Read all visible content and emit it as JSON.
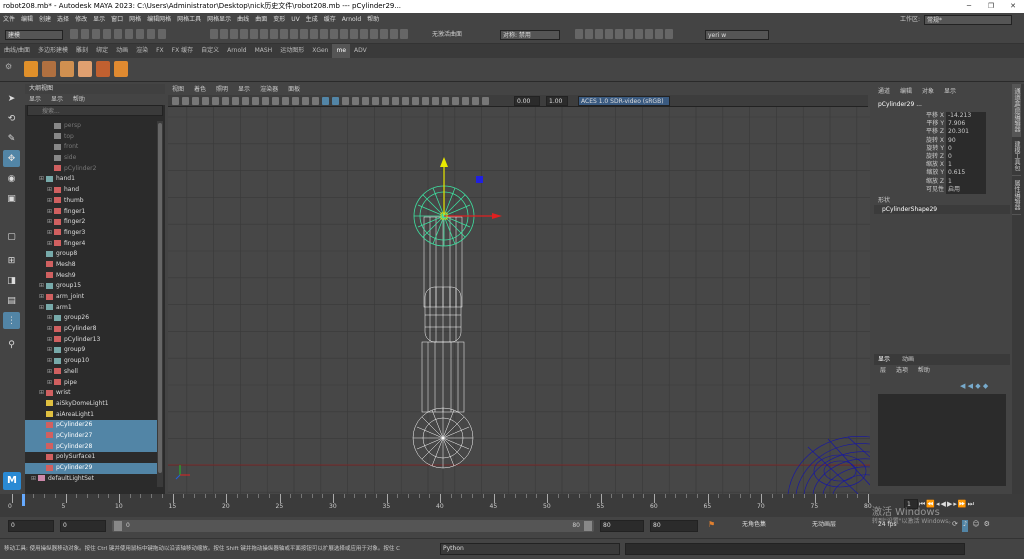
{
  "title": "robot208.mb* - Autodesk MAYA 2023: C:\\Users\\Administrator\\Desktop\\nick历史文件\\robot208.mb --- pCylinder29...",
  "menus": [
    "文件",
    "编辑",
    "创建",
    "选择",
    "修改",
    "显示",
    "窗口",
    "网格",
    "编辑网格",
    "网格工具",
    "网格显示",
    "曲线",
    "曲面",
    "变形",
    "UV",
    "生成",
    "缓存",
    "Arnold",
    "帮助"
  ],
  "workspace_label": "工作区:",
  "workspace_value": "常规*",
  "mode_value": "建模",
  "no_live_surface": "无激活曲面",
  "symmetry": "对称: 禁用",
  "user": "yeri w",
  "shelf_tabs": [
    "曲线/曲面",
    "多边形建模",
    "雕刻",
    "绑定",
    "动画",
    "渲染",
    "FX",
    "FX 缓存",
    "自定义",
    "Arnold",
    "MASH",
    "运动图形",
    "XGen",
    "me",
    "ADV"
  ],
  "shelf_active": 13,
  "outliner": {
    "header": "大纲视图",
    "menu": [
      "显示",
      "显示",
      "帮助"
    ],
    "search_placeholder": "搜索...",
    "items": [
      {
        "label": "persp",
        "indent": 2,
        "dim": true,
        "sel": false,
        "exp": false,
        "icon": "camera"
      },
      {
        "label": "top",
        "indent": 2,
        "dim": true,
        "sel": false,
        "exp": false,
        "icon": "camera"
      },
      {
        "label": "front",
        "indent": 2,
        "dim": true,
        "sel": false,
        "exp": false,
        "icon": "camera"
      },
      {
        "label": "side",
        "indent": 2,
        "dim": true,
        "sel": false,
        "exp": false,
        "icon": "camera"
      },
      {
        "label": "pCylinder2",
        "indent": 2,
        "dim": true,
        "sel": false,
        "exp": false,
        "icon": "mesh"
      },
      {
        "label": "hand1",
        "indent": 1,
        "dim": false,
        "sel": false,
        "exp": true,
        "icon": "group"
      },
      {
        "label": "hand",
        "indent": 2,
        "dim": false,
        "sel": false,
        "exp": true,
        "icon": "mesh"
      },
      {
        "label": "thumb",
        "indent": 2,
        "dim": false,
        "sel": false,
        "exp": true,
        "icon": "mesh"
      },
      {
        "label": "finger1",
        "indent": 2,
        "dim": false,
        "sel": false,
        "exp": true,
        "icon": "mesh"
      },
      {
        "label": "finger2",
        "indent": 2,
        "dim": false,
        "sel": false,
        "exp": true,
        "icon": "mesh"
      },
      {
        "label": "finger3",
        "indent": 2,
        "dim": false,
        "sel": false,
        "exp": true,
        "icon": "mesh"
      },
      {
        "label": "finger4",
        "indent": 2,
        "dim": false,
        "sel": false,
        "exp": true,
        "icon": "mesh"
      },
      {
        "label": "group8",
        "indent": 1,
        "dim": false,
        "sel": false,
        "exp": false,
        "icon": "group"
      },
      {
        "label": "Mesh8",
        "indent": 1,
        "dim": false,
        "sel": false,
        "exp": false,
        "icon": "mesh"
      },
      {
        "label": "Mesh9",
        "indent": 1,
        "dim": false,
        "sel": false,
        "exp": false,
        "icon": "mesh"
      },
      {
        "label": "group15",
        "indent": 1,
        "dim": false,
        "sel": false,
        "exp": true,
        "icon": "group"
      },
      {
        "label": "arm_joint",
        "indent": 1,
        "dim": false,
        "sel": false,
        "exp": true,
        "icon": "mesh"
      },
      {
        "label": "arm1",
        "indent": 1,
        "dim": false,
        "sel": false,
        "exp": true,
        "icon": "group"
      },
      {
        "label": "group26",
        "indent": 2,
        "dim": false,
        "sel": false,
        "exp": true,
        "icon": "group"
      },
      {
        "label": "pCylinder8",
        "indent": 2,
        "dim": false,
        "sel": false,
        "exp": true,
        "icon": "mesh"
      },
      {
        "label": "pCylinder13",
        "indent": 2,
        "dim": false,
        "sel": false,
        "exp": true,
        "icon": "mesh"
      },
      {
        "label": "group9",
        "indent": 2,
        "dim": false,
        "sel": false,
        "exp": true,
        "icon": "group"
      },
      {
        "label": "group10",
        "indent": 2,
        "dim": false,
        "sel": false,
        "exp": true,
        "icon": "group"
      },
      {
        "label": "shell",
        "indent": 2,
        "dim": false,
        "sel": false,
        "exp": true,
        "icon": "mesh"
      },
      {
        "label": "pipe",
        "indent": 2,
        "dim": false,
        "sel": false,
        "exp": true,
        "icon": "mesh"
      },
      {
        "label": "wrist",
        "indent": 1,
        "dim": false,
        "sel": false,
        "exp": true,
        "icon": "mesh"
      },
      {
        "label": "aiSkyDomeLight1",
        "indent": 1,
        "dim": false,
        "sel": false,
        "exp": false,
        "icon": "light"
      },
      {
        "label": "aiAreaLight1",
        "indent": 1,
        "dim": false,
        "sel": false,
        "exp": false,
        "icon": "light"
      },
      {
        "label": "pCylinder26",
        "indent": 1,
        "dim": false,
        "sel": true,
        "exp": false,
        "icon": "mesh"
      },
      {
        "label": "pCylinder27",
        "indent": 1,
        "dim": false,
        "sel": true,
        "exp": false,
        "icon": "mesh"
      },
      {
        "label": "pCylinder28",
        "indent": 1,
        "dim": false,
        "sel": true,
        "exp": false,
        "icon": "mesh"
      },
      {
        "label": "polySurface1",
        "indent": 1,
        "dim": false,
        "sel": false,
        "exp": false,
        "icon": "mesh"
      },
      {
        "label": "pCylinder29",
        "indent": 1,
        "dim": false,
        "sel": true,
        "exp": false,
        "icon": "mesh"
      },
      {
        "label": "defaultLightSet",
        "indent": 0,
        "dim": false,
        "sel": false,
        "exp": true,
        "icon": "set"
      }
    ]
  },
  "viewport_menu": [
    "视图",
    "着色",
    "照明",
    "显示",
    "渲染器",
    "面板"
  ],
  "viewport_fields": {
    "exposure": "0.00",
    "gamma": "1.00",
    "color_space": "ACES 1.0 SDR-video (sRGB)"
  },
  "channel_box": {
    "menu": [
      "通道",
      "编辑",
      "对象",
      "显示"
    ],
    "object": "pCylinder29 ...",
    "attrs": [
      {
        "label": "平移 X",
        "value": "-14.213"
      },
      {
        "label": "平移 Y",
        "value": "7.906"
      },
      {
        "label": "平移 Z",
        "value": "20.301"
      },
      {
        "label": "旋转 X",
        "value": "90"
      },
      {
        "label": "旋转 Y",
        "value": "0"
      },
      {
        "label": "旋转 Z",
        "value": "0"
      },
      {
        "label": "缩放 X",
        "value": "1"
      },
      {
        "label": "缩放 Y",
        "value": "0.615"
      },
      {
        "label": "缩放 Z",
        "value": "1"
      },
      {
        "label": "可见性",
        "value": "启用"
      }
    ],
    "shapes_label": "形状",
    "shape_name": "pCylinderShape29"
  },
  "layer_panel": {
    "tabs": [
      "显示",
      "动画"
    ],
    "menu": [
      "层",
      "选项",
      "帮助"
    ]
  },
  "right_tabs": [
    "通道盒/层编辑器",
    "建模工具包",
    "属性编辑器"
  ],
  "timeline": {
    "ticks": [
      "0",
      "5",
      "10",
      "15",
      "20",
      "25",
      "30",
      "35",
      "40",
      "45",
      "50",
      "55",
      "60",
      "65",
      "70",
      "75",
      "80"
    ],
    "current": "1"
  },
  "range": {
    "start": "0",
    "start2": "0",
    "range_start": "0",
    "range_end": "80",
    "end": "80",
    "end2": "80",
    "char_set": "无角色集",
    "anim_layer": "无动画层",
    "fps": "24 fps"
  },
  "cmd": {
    "help": "移动工具: 使用操纵器移动对象。按住 Ctrl 键并使用鼠标中键拖动以沿该轴移动缩放。按住 Shift 键并拖动操纵器轴或平面按钮可以扩展选择或应用于对象。按住 C",
    "lang": "Python"
  },
  "watermark": "激活 Windows",
  "watermark2": "转到\"设置\"以激活 Windows。",
  "colors": {
    "selection": "#5285a6",
    "manip_y": "#e8e800",
    "manip_x": "#e02020",
    "manip_z": "#2020e0",
    "ring": "#3fe0a0",
    "wire": "#ffffff",
    "blue_wire": "#1010a0"
  }
}
